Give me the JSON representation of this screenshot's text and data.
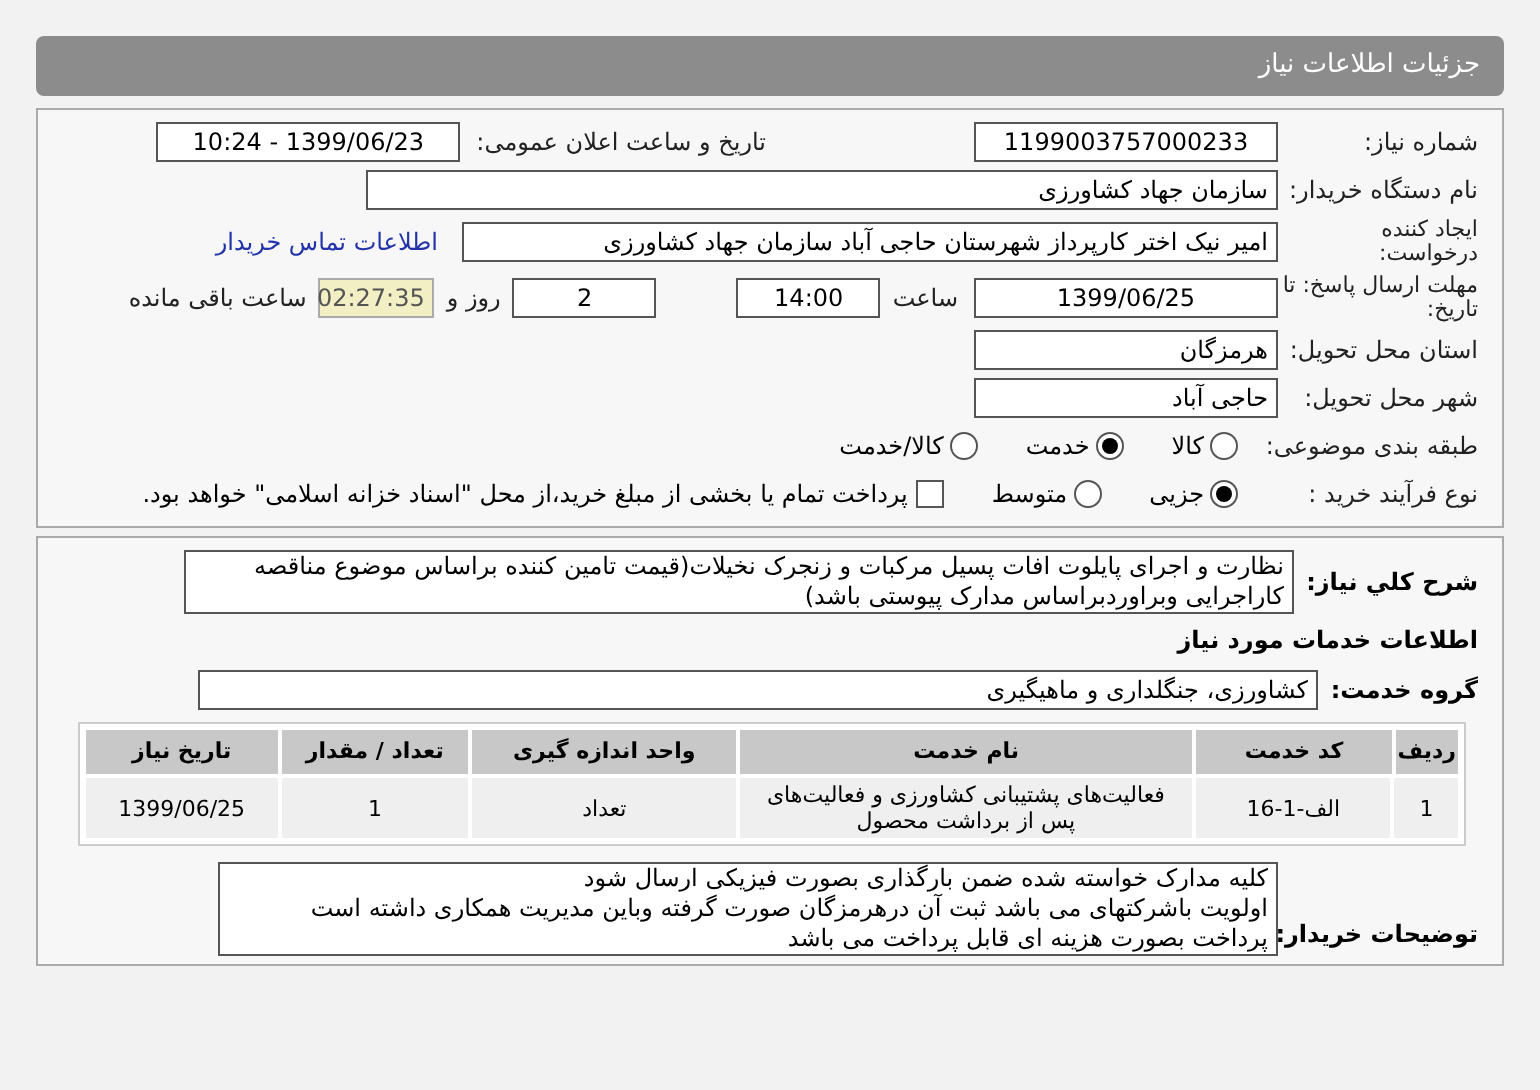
{
  "header": {
    "title": "جزئیات اطلاعات نیاز"
  },
  "need_number": {
    "label": "شماره نیاز:",
    "value": "1199003757000233"
  },
  "announce_date": {
    "label": "تاریخ و ساعت اعلان عمومی:",
    "value": "1399/06/23 - 10:24"
  },
  "buyer_org": {
    "label": "نام دستگاه خریدار:",
    "value": "سازمان جهاد کشاورزی"
  },
  "requester": {
    "label": "ایجاد کننده درخواست:",
    "value": "امیر نیک اختر کارپرداز شهرستان حاجی آباد سازمان جهاد کشاورزی",
    "link": "اطلاعات تماس خریدار"
  },
  "deadline": {
    "label": "مهلت ارسال پاسخ: تا تاریخ:",
    "date": "1399/06/25",
    "time_label": "ساعت",
    "time": "14:00",
    "days": "2",
    "days_label": "روز و",
    "remaining": "02:27:35",
    "remaining_label": "ساعت باقی مانده"
  },
  "province": {
    "label": "استان محل تحویل:",
    "value": "هرمزگان"
  },
  "city": {
    "label": "شهر محل تحویل:",
    "value": "حاجی آباد"
  },
  "category": {
    "label": "طبقه بندی موضوعی:",
    "options": [
      {
        "label": "کالا",
        "selected": false
      },
      {
        "label": "خدمت",
        "selected": true
      },
      {
        "label": "کالا/خدمت",
        "selected": false
      }
    ]
  },
  "process": {
    "label": "نوع فرآیند خرید :",
    "options": [
      {
        "label": "جزیی",
        "selected": true
      },
      {
        "label": "متوسط",
        "selected": false
      }
    ],
    "payment": {
      "label": "پرداخت تمام یا بخشی از مبلغ خرید،از محل \"اسناد خزانه اسلامی\" خواهد بود.",
      "checked": false
    }
  },
  "description": {
    "label": "شرح کلي نياز:",
    "value": "نظارت و اجرای پایلوت افات پسیل مرکبات و زنجرک نخیلات(قیمت تامین کننده براساس موضوع مناقصه کاراجرایی وبراوردبراساس مدارک پیوستی باشد)"
  },
  "services_title": "اطلاعات خدمات مورد نیاز",
  "service_group": {
    "label": "گروه خدمت:",
    "value": "کشاورزی، جنگلداری و ماهیگیری"
  },
  "table": {
    "columns": [
      "ردیف",
      "کد خدمت",
      "نام خدمت",
      "واحد اندازه گیری",
      "تعداد / مقدار",
      "تاریخ نیاز"
    ],
    "rows": [
      [
        "1",
        "الف-1-16",
        "فعالیت‌های پشتیبانی کشاورزی و فعالیت‌های پس از برداشت محصول",
        "تعداد",
        "1",
        "1399/06/25"
      ]
    ]
  },
  "buyer_notes": {
    "label": "توضیحات خریدار:",
    "lines": [
      "کلیه مدارک خواسته شده ضمن بارگذاری بصورت فیزیکی ارسال شود",
      "اولویت باشرکتهای می باشد ثبت آن درهرمزگان صورت گرفته وباین مدیریت همکاری داشته است",
      "پرداخت بصورت هزینه ای قابل پرداخت می باشد"
    ]
  }
}
